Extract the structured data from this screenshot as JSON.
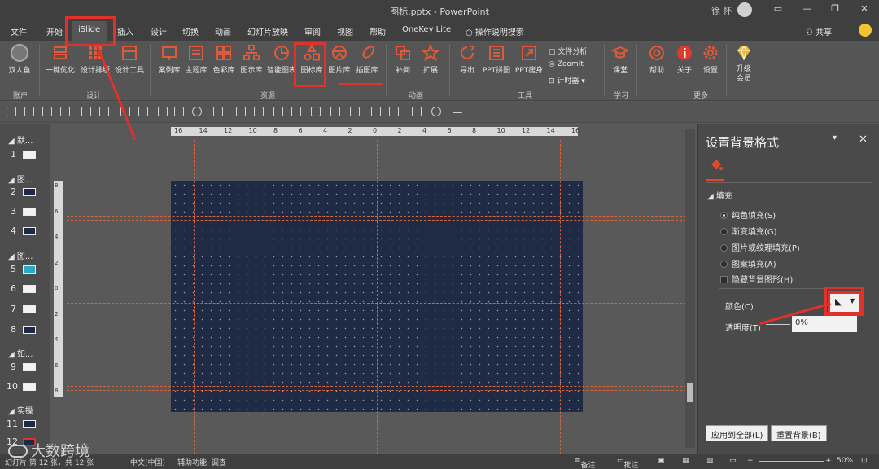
{
  "window": {
    "title": "图标.pptx  -  PowerPoint",
    "user": "徐 怀",
    "controls": [
      "▭",
      "—",
      "❐",
      "✕"
    ]
  },
  "tabs": [
    "文件",
    "开始",
    "iSlide",
    "插入",
    "设计",
    "切换",
    "动画",
    "幻灯片放映",
    "审阅",
    "视图",
    "帮助",
    "OneKey Lite",
    "操作说明搜索"
  ],
  "share_label": "共享",
  "ribbon": {
    "buttons": [
      "双人鱼",
      "一键优化",
      "设计排版",
      "设计工具",
      "案例库",
      "主题库",
      "色彩库",
      "图示库",
      "智能图表",
      "图标库",
      "图片库",
      "插图库",
      "补间",
      "扩展",
      "导出",
      "PPT拼图",
      "PPT瘦身",
      "课堂",
      "帮助",
      "关于",
      "设置",
      "升级会员"
    ],
    "small_buttons": [
      "文件分析",
      "ZoomIt",
      "计时器"
    ],
    "groups": [
      "账户",
      "设计",
      "资源",
      "动画",
      "工具",
      "学习",
      "更多"
    ]
  },
  "ruler": {
    "h_ticks": [
      "16",
      "14",
      "12",
      "10",
      "8",
      "6",
      "4",
      "2",
      "0",
      "2",
      "4",
      "6",
      "8",
      "10",
      "12",
      "14",
      "16"
    ],
    "v_ticks": [
      "8",
      "6",
      "4",
      "2",
      "0",
      "2",
      "4",
      "6",
      "8"
    ]
  },
  "slides_panel": {
    "sections": [
      "默...",
      "图...",
      "图...",
      "如...",
      "实操"
    ],
    "numbers": [
      "1",
      "2",
      "3",
      "4",
      "5",
      "6",
      "7",
      "8",
      "9",
      "10",
      "11",
      "12"
    ]
  },
  "format_pane": {
    "title": "设置背景格式",
    "section": "填充",
    "options": [
      "纯色填充(S)",
      "渐变填充(G)",
      "图片或纹理填充(P)",
      "图案填充(A)"
    ],
    "hide_graphics": "隐藏背景图形(H)",
    "color_label": "颜色(C)",
    "transparency_label": "透明度(T)",
    "transparency_value": "0%",
    "apply_all": "应用到全部(L)",
    "reset": "重置背景(B)"
  },
  "status": {
    "slide_info": "幻灯片 第 12 张，共 12 张",
    "language": "中文(中国)",
    "accessibility": "辅助功能: 调查",
    "notes": "备注",
    "comments": "批注",
    "zoom": "50%"
  },
  "watermark": "大数跨境",
  "colors": {
    "accent": "#e0312a",
    "slide_bg": "#1f2a45",
    "guide": "#d2653f"
  }
}
